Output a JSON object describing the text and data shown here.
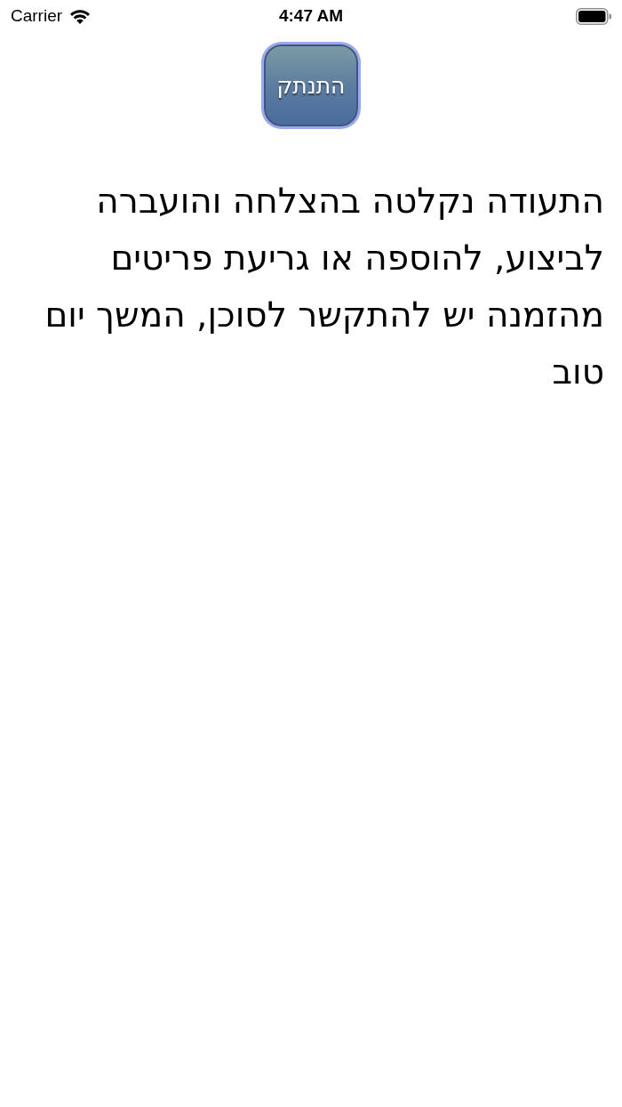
{
  "status_bar": {
    "carrier": "Carrier",
    "time": "4:47 AM"
  },
  "disconnect_button": {
    "label": "התנתק"
  },
  "message": "התעודה נקלטה בהצלחה והועברה לביצוע, להוספה או גריעת פריטים מהזמנה יש להתקשר לסוכן, המשך יום טוב"
}
